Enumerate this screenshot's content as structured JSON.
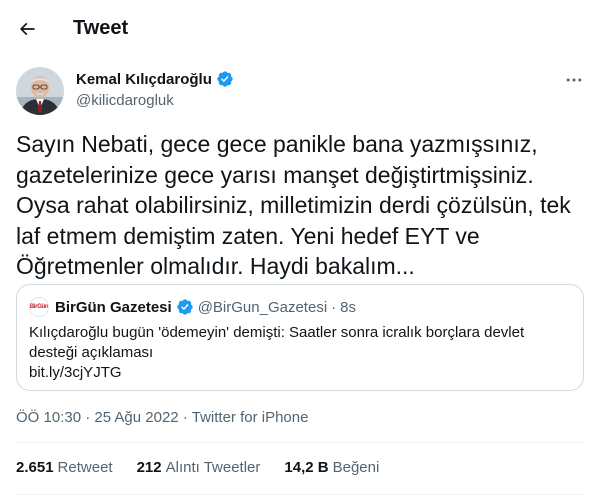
{
  "header": {
    "title": "Tweet",
    "back_icon": "arrow-left-icon"
  },
  "author": {
    "name": "Kemal Kılıçdaroğlu",
    "handle": "@kilicdarogluk",
    "verified": true,
    "verified_color": "#1d9bf0"
  },
  "tweet": {
    "text": "Sayın Nebati, gece gece panikle bana yazmışsınız, gazetelerinize gece yarısı manşet değiştirtmişsiniz. Oysa rahat olabilirsiniz, milletimizin derdi çözülsün, tek laf etmem demiştim zaten. Yeni hedef EYT ve Öğretmenler olmalıdır. Haydi bakalım..."
  },
  "quote": {
    "avatar_text": "BirGün",
    "name": "BirGün Gazetesi",
    "handle": "@BirGun_Gazetesi",
    "separator": "·",
    "time": "8s",
    "text": "Kılıçdaroğlu bugün 'ödemeyin' demişti: Saatler sonra icralık borçlara devlet desteği açıklaması",
    "link": "bit.ly/3cjYJTG"
  },
  "meta": {
    "time": "ÖÖ 10:30",
    "sep1": "·",
    "date": "25 Ağu 2022",
    "sep2": "·",
    "source": "Twitter for iPhone"
  },
  "stats": {
    "retweets": {
      "count": "2.651",
      "label": "Retweet"
    },
    "quotes": {
      "count": "212",
      "label": "Alıntı Tweetler"
    },
    "likes": {
      "count": "14,2 B",
      "label": "Beğeni"
    }
  },
  "colors": {
    "text": "#0f1419",
    "secondary": "#536471",
    "border": "#cfd9de",
    "divider": "#eff3f4",
    "brand_red": "#c4161c"
  }
}
